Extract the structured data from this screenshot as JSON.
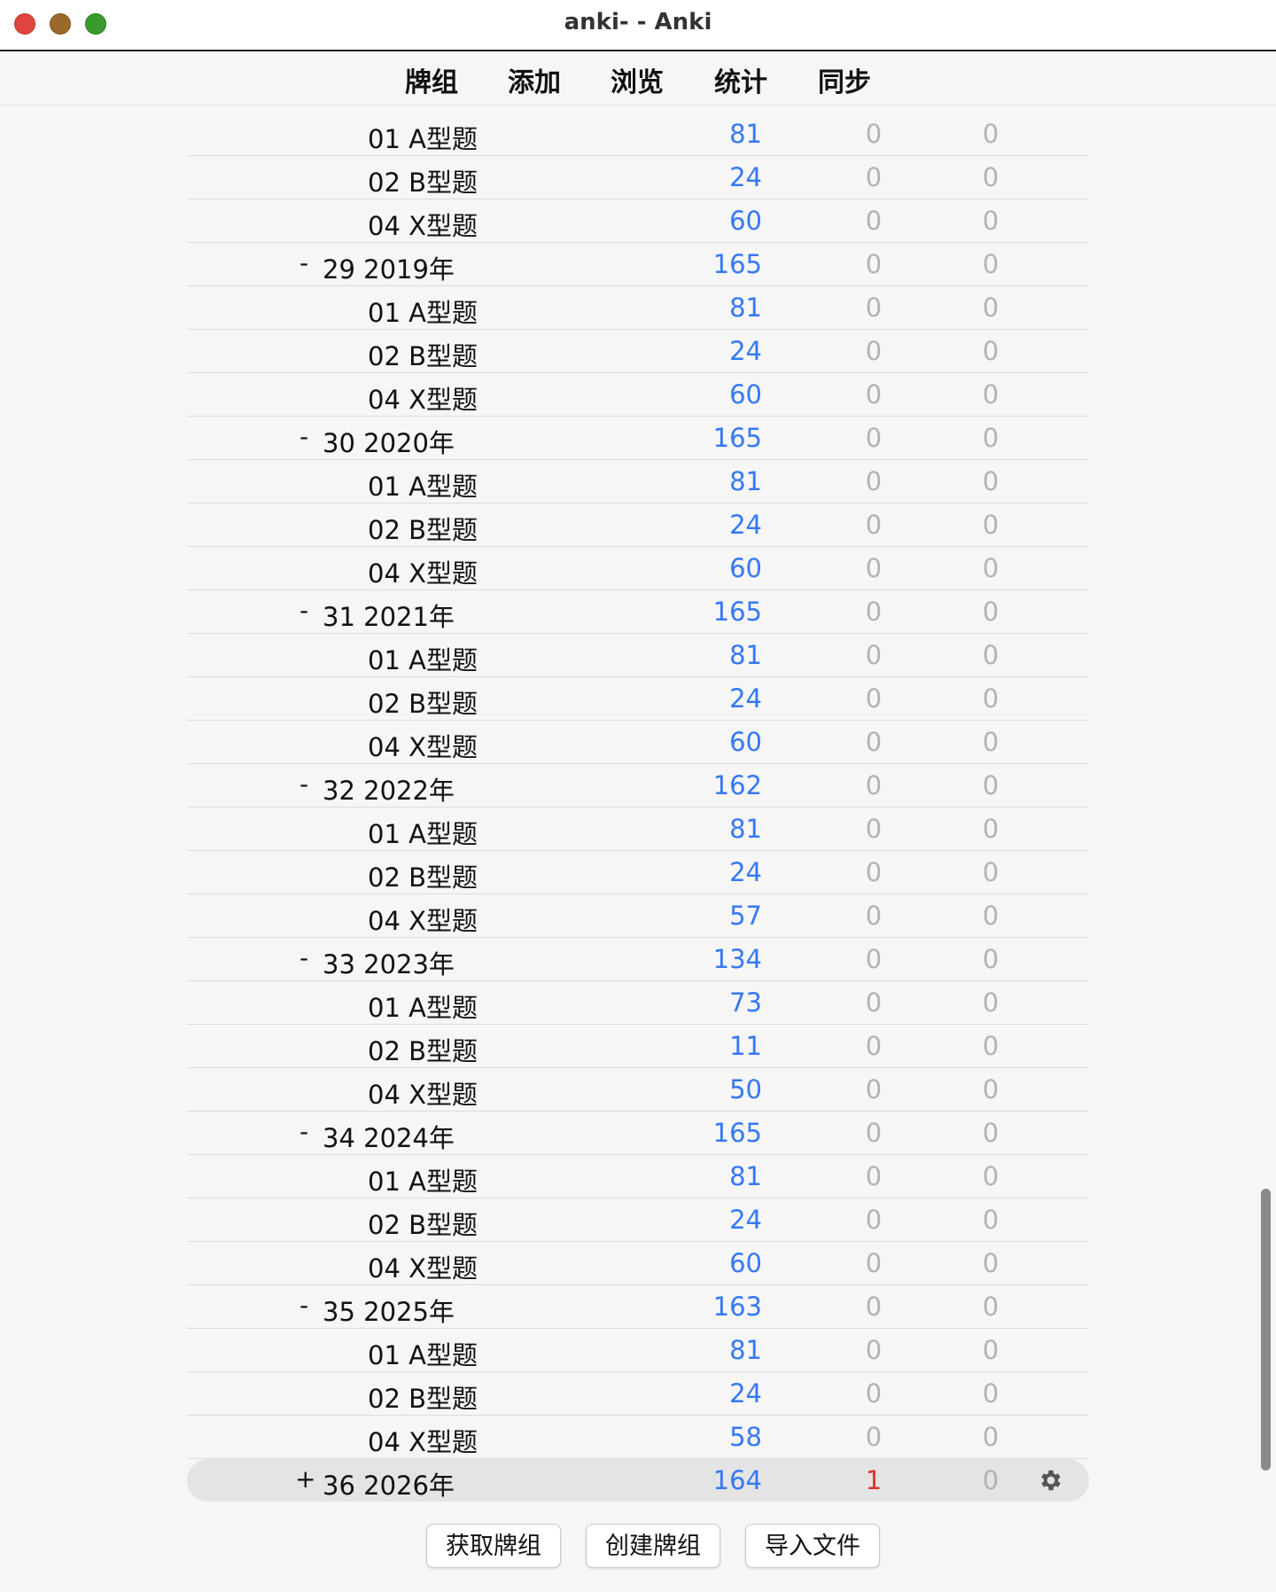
{
  "window": {
    "title": "anki- - Anki"
  },
  "toolbar": {
    "decks_label": "牌组",
    "add_label": "添加",
    "browse_label": "浏览",
    "stats_label": "统计",
    "sync_label": "同步"
  },
  "deck_rows": [
    {
      "level": 2,
      "toggle": "",
      "name": "01 A型题",
      "due": "81",
      "new": "0",
      "learn": "0"
    },
    {
      "level": 2,
      "toggle": "",
      "name": "02 B型题",
      "due": "24",
      "new": "0",
      "learn": "0"
    },
    {
      "level": 2,
      "toggle": "",
      "name": "04 X型题",
      "due": "60",
      "new": "0",
      "learn": "0"
    },
    {
      "level": 1,
      "toggle": "-",
      "name": "29 2019年",
      "due": "165",
      "new": "0",
      "learn": "0"
    },
    {
      "level": 2,
      "toggle": "",
      "name": "01 A型题",
      "due": "81",
      "new": "0",
      "learn": "0"
    },
    {
      "level": 2,
      "toggle": "",
      "name": "02 B型题",
      "due": "24",
      "new": "0",
      "learn": "0"
    },
    {
      "level": 2,
      "toggle": "",
      "name": "04 X型题",
      "due": "60",
      "new": "0",
      "learn": "0"
    },
    {
      "level": 1,
      "toggle": "-",
      "name": "30 2020年",
      "due": "165",
      "new": "0",
      "learn": "0"
    },
    {
      "level": 2,
      "toggle": "",
      "name": "01 A型题",
      "due": "81",
      "new": "0",
      "learn": "0"
    },
    {
      "level": 2,
      "toggle": "",
      "name": "02 B型题",
      "due": "24",
      "new": "0",
      "learn": "0"
    },
    {
      "level": 2,
      "toggle": "",
      "name": "04 X型题",
      "due": "60",
      "new": "0",
      "learn": "0"
    },
    {
      "level": 1,
      "toggle": "-",
      "name": "31 2021年",
      "due": "165",
      "new": "0",
      "learn": "0"
    },
    {
      "level": 2,
      "toggle": "",
      "name": "01 A型题",
      "due": "81",
      "new": "0",
      "learn": "0"
    },
    {
      "level": 2,
      "toggle": "",
      "name": "02 B型题",
      "due": "24",
      "new": "0",
      "learn": "0"
    },
    {
      "level": 2,
      "toggle": "",
      "name": "04 X型题",
      "due": "60",
      "new": "0",
      "learn": "0"
    },
    {
      "level": 1,
      "toggle": "-",
      "name": "32 2022年",
      "due": "162",
      "new": "0",
      "learn": "0"
    },
    {
      "level": 2,
      "toggle": "",
      "name": "01 A型题",
      "due": "81",
      "new": "0",
      "learn": "0"
    },
    {
      "level": 2,
      "toggle": "",
      "name": "02 B型题",
      "due": "24",
      "new": "0",
      "learn": "0"
    },
    {
      "level": 2,
      "toggle": "",
      "name": "04 X型题",
      "due": "57",
      "new": "0",
      "learn": "0"
    },
    {
      "level": 1,
      "toggle": "-",
      "name": "33 2023年",
      "due": "134",
      "new": "0",
      "learn": "0"
    },
    {
      "level": 2,
      "toggle": "",
      "name": "01 A型题",
      "due": "73",
      "new": "0",
      "learn": "0"
    },
    {
      "level": 2,
      "toggle": "",
      "name": "02 B型题",
      "due": "11",
      "new": "0",
      "learn": "0"
    },
    {
      "level": 2,
      "toggle": "",
      "name": "04 X型题",
      "due": "50",
      "new": "0",
      "learn": "0"
    },
    {
      "level": 1,
      "toggle": "-",
      "name": "34 2024年",
      "due": "165",
      "new": "0",
      "learn": "0"
    },
    {
      "level": 2,
      "toggle": "",
      "name": "01 A型题",
      "due": "81",
      "new": "0",
      "learn": "0"
    },
    {
      "level": 2,
      "toggle": "",
      "name": "02 B型题",
      "due": "24",
      "new": "0",
      "learn": "0"
    },
    {
      "level": 2,
      "toggle": "",
      "name": "04 X型题",
      "due": "60",
      "new": "0",
      "learn": "0"
    },
    {
      "level": 1,
      "toggle": "-",
      "name": "35 2025年",
      "due": "163",
      "new": "0",
      "learn": "0"
    },
    {
      "level": 2,
      "toggle": "",
      "name": "01 A型题",
      "due": "81",
      "new": "0",
      "learn": "0"
    },
    {
      "level": 2,
      "toggle": "",
      "name": "02 B型题",
      "due": "24",
      "new": "0",
      "learn": "0"
    },
    {
      "level": 2,
      "toggle": "",
      "name": "04 X型题",
      "due": "58",
      "new": "0",
      "learn": "0"
    }
  ],
  "current_deck": {
    "toggle": "+",
    "name": "36 2026年",
    "due": "164",
    "new": "1",
    "learn": "0",
    "icon": "gear-icon"
  },
  "bottom_buttons": {
    "get_shared_label": "获取牌组",
    "create_deck_label": "创建牌组",
    "import_file_label": "导入文件"
  },
  "colors": {
    "due": "#3478f6",
    "zero": "#b3b3b3",
    "new_nonzero": "#e0302a"
  }
}
